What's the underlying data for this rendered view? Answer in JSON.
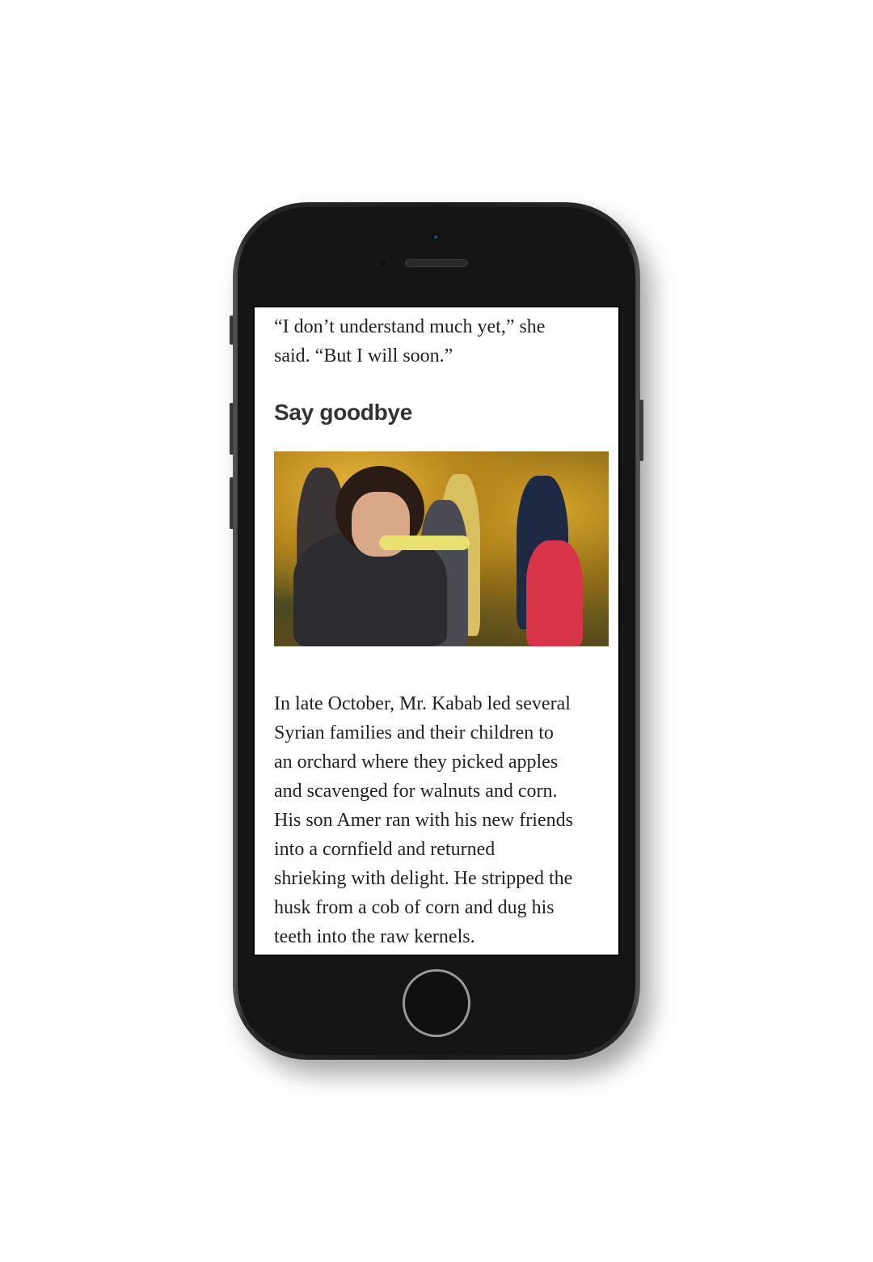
{
  "article": {
    "quote_lines": [
      "“I don’t understand much yet,” she",
      "said. “But I will soon.”"
    ],
    "section_heading": "Say goodbye",
    "photo": {
      "description_icon": "photo-children-eating-corn-in-orchard"
    },
    "paragraph_lines": [
      "In late October, Mr. Kabab led several",
      "Syrian families and their children to",
      "an orchard where they picked apples",
      "and scavenged for walnuts and corn.",
      "His son Amer ran with his new friends",
      "into a cornfield and returned",
      "shrieking with delight. He stripped the",
      "husk from a cob of corn and dug his",
      "teeth into the raw kernels."
    ]
  },
  "colors": {
    "text": "#222222",
    "heading": "#333333",
    "phone_body": "#151515"
  }
}
